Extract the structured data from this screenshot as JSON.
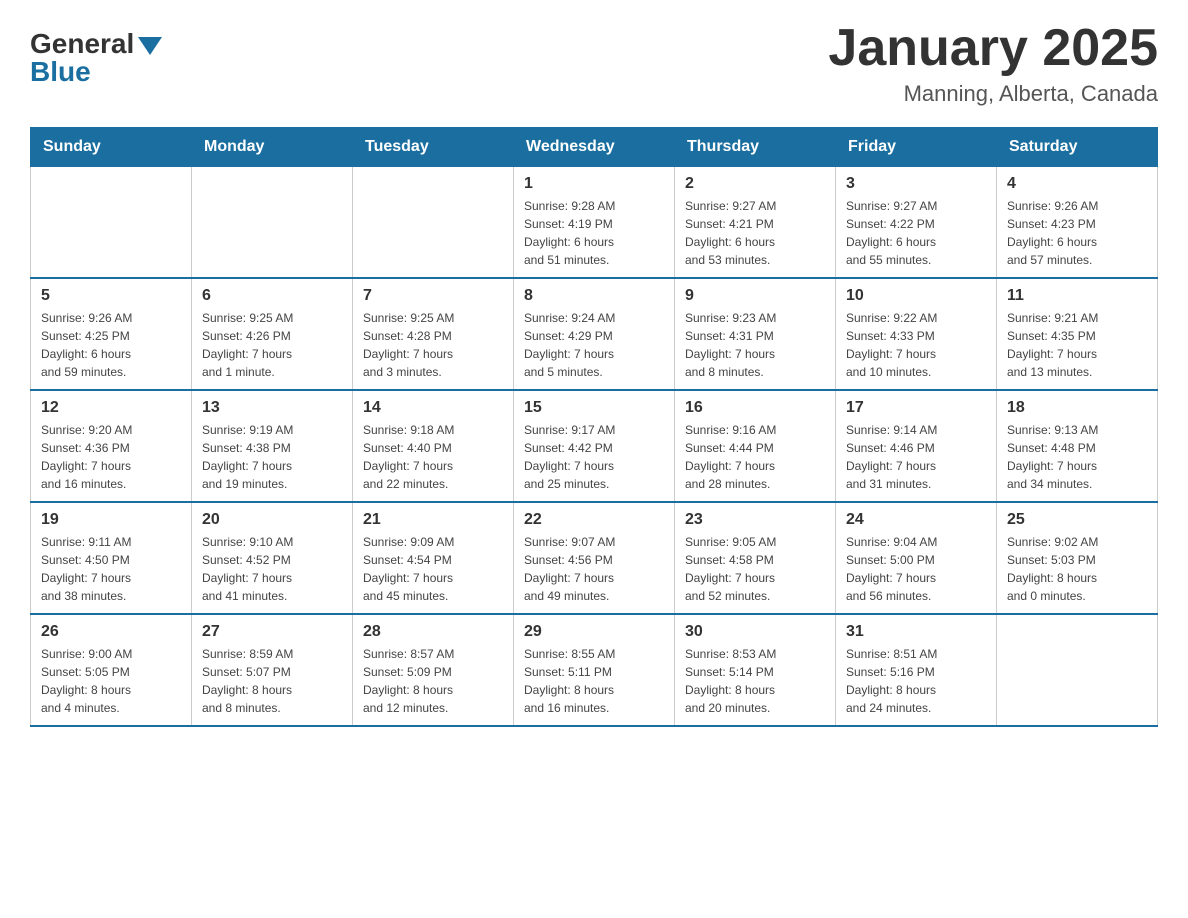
{
  "header": {
    "logo_line1": "General",
    "logo_line2": "Blue",
    "month": "January 2025",
    "location": "Manning, Alberta, Canada"
  },
  "weekdays": [
    "Sunday",
    "Monday",
    "Tuesday",
    "Wednesday",
    "Thursday",
    "Friday",
    "Saturday"
  ],
  "weeks": [
    [
      {
        "day": "",
        "info": ""
      },
      {
        "day": "",
        "info": ""
      },
      {
        "day": "",
        "info": ""
      },
      {
        "day": "1",
        "info": "Sunrise: 9:28 AM\nSunset: 4:19 PM\nDaylight: 6 hours\nand 51 minutes."
      },
      {
        "day": "2",
        "info": "Sunrise: 9:27 AM\nSunset: 4:21 PM\nDaylight: 6 hours\nand 53 minutes."
      },
      {
        "day": "3",
        "info": "Sunrise: 9:27 AM\nSunset: 4:22 PM\nDaylight: 6 hours\nand 55 minutes."
      },
      {
        "day": "4",
        "info": "Sunrise: 9:26 AM\nSunset: 4:23 PM\nDaylight: 6 hours\nand 57 minutes."
      }
    ],
    [
      {
        "day": "5",
        "info": "Sunrise: 9:26 AM\nSunset: 4:25 PM\nDaylight: 6 hours\nand 59 minutes."
      },
      {
        "day": "6",
        "info": "Sunrise: 9:25 AM\nSunset: 4:26 PM\nDaylight: 7 hours\nand 1 minute."
      },
      {
        "day": "7",
        "info": "Sunrise: 9:25 AM\nSunset: 4:28 PM\nDaylight: 7 hours\nand 3 minutes."
      },
      {
        "day": "8",
        "info": "Sunrise: 9:24 AM\nSunset: 4:29 PM\nDaylight: 7 hours\nand 5 minutes."
      },
      {
        "day": "9",
        "info": "Sunrise: 9:23 AM\nSunset: 4:31 PM\nDaylight: 7 hours\nand 8 minutes."
      },
      {
        "day": "10",
        "info": "Sunrise: 9:22 AM\nSunset: 4:33 PM\nDaylight: 7 hours\nand 10 minutes."
      },
      {
        "day": "11",
        "info": "Sunrise: 9:21 AM\nSunset: 4:35 PM\nDaylight: 7 hours\nand 13 minutes."
      }
    ],
    [
      {
        "day": "12",
        "info": "Sunrise: 9:20 AM\nSunset: 4:36 PM\nDaylight: 7 hours\nand 16 minutes."
      },
      {
        "day": "13",
        "info": "Sunrise: 9:19 AM\nSunset: 4:38 PM\nDaylight: 7 hours\nand 19 minutes."
      },
      {
        "day": "14",
        "info": "Sunrise: 9:18 AM\nSunset: 4:40 PM\nDaylight: 7 hours\nand 22 minutes."
      },
      {
        "day": "15",
        "info": "Sunrise: 9:17 AM\nSunset: 4:42 PM\nDaylight: 7 hours\nand 25 minutes."
      },
      {
        "day": "16",
        "info": "Sunrise: 9:16 AM\nSunset: 4:44 PM\nDaylight: 7 hours\nand 28 minutes."
      },
      {
        "day": "17",
        "info": "Sunrise: 9:14 AM\nSunset: 4:46 PM\nDaylight: 7 hours\nand 31 minutes."
      },
      {
        "day": "18",
        "info": "Sunrise: 9:13 AM\nSunset: 4:48 PM\nDaylight: 7 hours\nand 34 minutes."
      }
    ],
    [
      {
        "day": "19",
        "info": "Sunrise: 9:11 AM\nSunset: 4:50 PM\nDaylight: 7 hours\nand 38 minutes."
      },
      {
        "day": "20",
        "info": "Sunrise: 9:10 AM\nSunset: 4:52 PM\nDaylight: 7 hours\nand 41 minutes."
      },
      {
        "day": "21",
        "info": "Sunrise: 9:09 AM\nSunset: 4:54 PM\nDaylight: 7 hours\nand 45 minutes."
      },
      {
        "day": "22",
        "info": "Sunrise: 9:07 AM\nSunset: 4:56 PM\nDaylight: 7 hours\nand 49 minutes."
      },
      {
        "day": "23",
        "info": "Sunrise: 9:05 AM\nSunset: 4:58 PM\nDaylight: 7 hours\nand 52 minutes."
      },
      {
        "day": "24",
        "info": "Sunrise: 9:04 AM\nSunset: 5:00 PM\nDaylight: 7 hours\nand 56 minutes."
      },
      {
        "day": "25",
        "info": "Sunrise: 9:02 AM\nSunset: 5:03 PM\nDaylight: 8 hours\nand 0 minutes."
      }
    ],
    [
      {
        "day": "26",
        "info": "Sunrise: 9:00 AM\nSunset: 5:05 PM\nDaylight: 8 hours\nand 4 minutes."
      },
      {
        "day": "27",
        "info": "Sunrise: 8:59 AM\nSunset: 5:07 PM\nDaylight: 8 hours\nand 8 minutes."
      },
      {
        "day": "28",
        "info": "Sunrise: 8:57 AM\nSunset: 5:09 PM\nDaylight: 8 hours\nand 12 minutes."
      },
      {
        "day": "29",
        "info": "Sunrise: 8:55 AM\nSunset: 5:11 PM\nDaylight: 8 hours\nand 16 minutes."
      },
      {
        "day": "30",
        "info": "Sunrise: 8:53 AM\nSunset: 5:14 PM\nDaylight: 8 hours\nand 20 minutes."
      },
      {
        "day": "31",
        "info": "Sunrise: 8:51 AM\nSunset: 5:16 PM\nDaylight: 8 hours\nand 24 minutes."
      },
      {
        "day": "",
        "info": ""
      }
    ]
  ]
}
